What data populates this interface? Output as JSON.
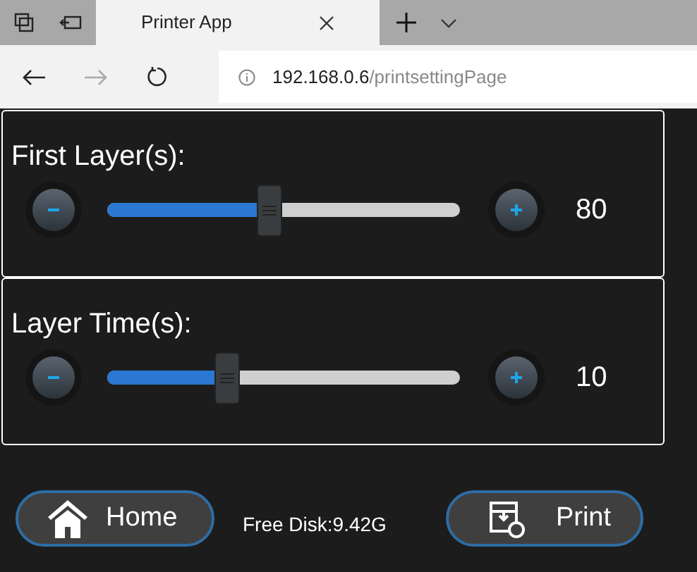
{
  "browser": {
    "tab_title": "Printer App",
    "url_host": "192.168.0.6",
    "url_path": "/printsettingPage"
  },
  "settings": [
    {
      "label": "First Layer(s):",
      "level": 0.46,
      "value": "80"
    },
    {
      "label": "Layer Time(s):",
      "level": 0.34,
      "value": "10"
    }
  ],
  "footer": {
    "home_label": "Home",
    "free_disk": "Free Disk:9.42G",
    "print_label": "Print"
  }
}
